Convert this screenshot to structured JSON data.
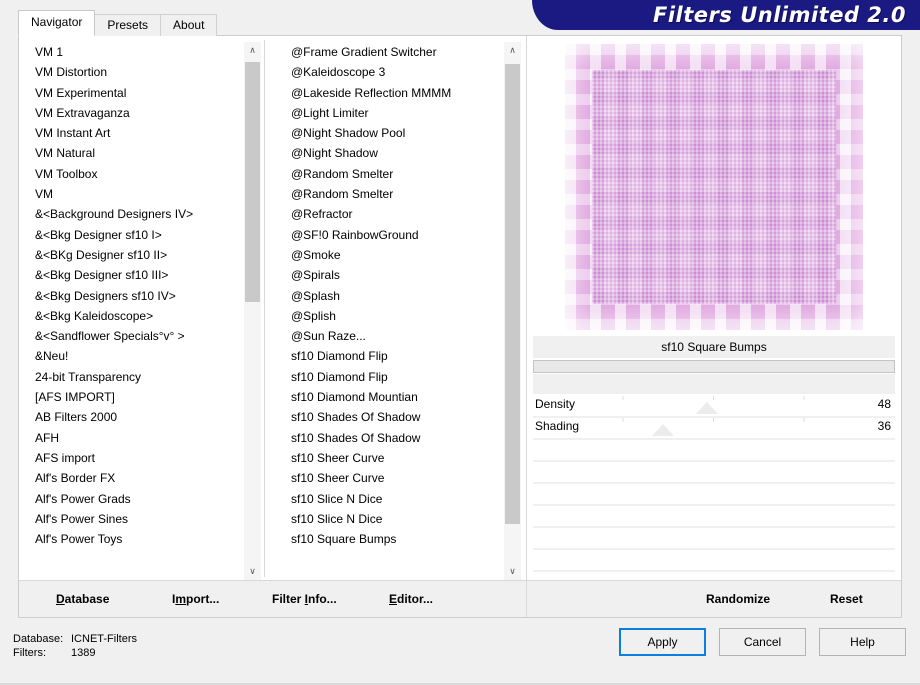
{
  "banner": {
    "title": "Filters Unlimited 2.0"
  },
  "tabs": [
    {
      "label": "Navigator",
      "active": true
    },
    {
      "label": "Presets",
      "active": false
    },
    {
      "label": "About",
      "active": false
    }
  ],
  "category_list": {
    "selected": "&<Background Designers IV>",
    "items": [
      "VM 1",
      "VM Distortion",
      "VM Experimental",
      "VM Extravaganza",
      "VM Instant Art",
      "VM Natural",
      "VM Toolbox",
      "VM",
      "&<Background Designers IV>",
      "&<Bkg Designer sf10 I>",
      "&<BKg Designer sf10 II>",
      "&<Bkg Designer sf10 III>",
      "&<Bkg Designers sf10 IV>",
      "&<Bkg Kaleidoscope>",
      "&<Sandflower Specials°v° >",
      "&Neu!",
      "24-bit Transparency",
      "[AFS IMPORT]",
      "AB Filters 2000",
      "AFH",
      "AFS import",
      "Alf's Border FX",
      "Alf's Power Grads",
      "Alf's Power Sines",
      "Alf's Power Toys"
    ]
  },
  "filter_list": {
    "selected": "sf10 Square Bumps",
    "items": [
      "@Frame Gradient Switcher",
      "@Kaleidoscope 3",
      "@Lakeside Reflection MMMM",
      "@Light Limiter",
      "@Night Shadow Pool",
      "@Night Shadow",
      "@Random Smelter",
      "@Random Smelter",
      "@Refractor",
      "@SF!0 RainbowGround",
      "@Smoke",
      "@Spirals",
      "@Splash",
      "@Splish",
      "@Sun Raze...",
      "sf10 Diamond Flip",
      "sf10 Diamond Flip",
      "sf10 Diamond Mountian",
      "sf10 Shades Of Shadow",
      "sf10 Shades Of Shadow",
      "sf10 Sheer Curve",
      "sf10 Sheer Curve",
      "sf10 Slice N Dice",
      "sf10 Slice N Dice",
      "sf10 Square Bumps"
    ]
  },
  "preview": {
    "filter_name": "sf10 Square Bumps"
  },
  "parameters": [
    {
      "label": "Density",
      "value": "48",
      "percent": 48
    },
    {
      "label": "Shading",
      "value": "36",
      "percent": 36
    }
  ],
  "empty_slider_rows": 7,
  "action_bar": {
    "database": {
      "pre": "",
      "accel": "D",
      "post": "atabase"
    },
    "import": {
      "pre": "I",
      "accel": "m",
      "post": "port..."
    },
    "filter_info": {
      "pre": "Filter ",
      "accel": "I",
      "post": "nfo..."
    },
    "editor": {
      "pre": "",
      "accel": "E",
      "post": "ditor..."
    },
    "randomize": "Randomize",
    "reset": "Reset"
  },
  "status": {
    "database_key": "Database:",
    "database_value": "ICNET-Filters",
    "filters_key": "Filters:",
    "filters_value": "1389"
  },
  "footer_buttons": [
    {
      "label": "Apply",
      "primary": true
    },
    {
      "label": "Cancel",
      "primary": false
    },
    {
      "label": "Help",
      "primary": false
    }
  ],
  "colors": {
    "banner_bg": "#1a1a82",
    "focus_border": "#0a7fe0",
    "selection_bg": "#ebebeb",
    "preview_pink": "#e4a9e8"
  },
  "scrollbars": {
    "up_glyph": "∧",
    "down_glyph": "∨"
  }
}
